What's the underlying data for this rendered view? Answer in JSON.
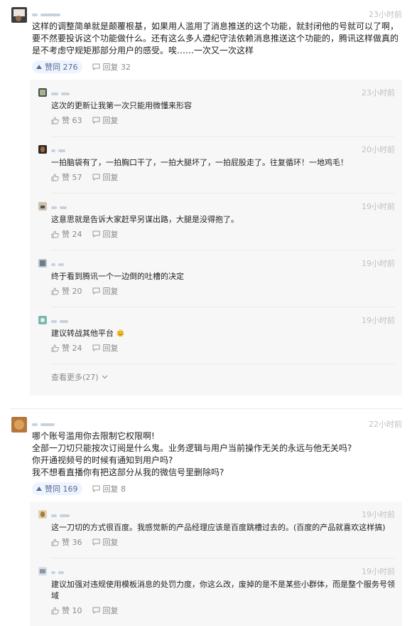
{
  "comments": [
    {
      "time": "23小时前",
      "text": "这样的调整简单就是颠覆根基，如果用人滥用了消息推送的这个功能，就封闭他的号就可以了啊，要不然要投诉这个功能做什么。还有这么多人遵纪守法依赖消息推送这个功能的，腾讯这样做真的是不考虑守规矩那部分用户的感受。唉……一次又一次这样",
      "likes": "赞同 276",
      "reply_count": "回复 32",
      "replies": [
        {
          "time": "23小时前",
          "text": "这次的更新让我第一次只能用微懂来形容",
          "likes": "赞 63",
          "reply_label": "回复"
        },
        {
          "time": "20小时前",
          "text": "一拍脑袋有了，一拍胸口干了，一拍大腿坏了，一拍屁股走了。往复循环！一地鸡毛！",
          "likes": "赞 57",
          "reply_label": "回复"
        },
        {
          "time": "19小时前",
          "text": "这意思就是告诉大家赶早另谋出路，大腿是没得抱了。",
          "likes": "赞 24",
          "reply_label": "回复"
        },
        {
          "time": "19小时前",
          "text": "终于看到腾讯一个一边倒的吐槽的决定",
          "likes": "赞 20",
          "reply_label": "回复"
        },
        {
          "time": "19小时前",
          "text": "建议转战其他平台",
          "likes": "赞 24",
          "reply_label": "回复"
        }
      ],
      "more_label": "查看更多(27)"
    },
    {
      "time": "22小时前",
      "text_lines": [
        "哪个账号滥用你去限制它权限啊!",
        "全部一刀切只能按次订阅是什么鬼。业务逻辑与用户当前操作无关的永远与他无关吗?",
        "你开通视频号的时候有通知到用户吗?",
        "我不想看直播你有把这部分从我的微信号里删除吗?"
      ],
      "likes": "赞同 169",
      "reply_count": "回复 8",
      "replies": [
        {
          "time": "19小时前",
          "text": "这一刀切的方式很百度。我感觉新的产品经理应该是百度跳槽过去的。(百度的产品就喜欢这样搞)",
          "likes": "赞 36",
          "reply_label": "回复"
        },
        {
          "time": "19小时前",
          "text": "建议加强对违规使用模板消息的处罚力度，你这么改，废掉的是不是某些小群体，而是整个服务号领域",
          "likes": "赞 10",
          "reply_label": "回复"
        }
      ]
    }
  ],
  "colors": {
    "accent": "#576b95",
    "like_bg": "#eef4ff",
    "reply_bg": "#f7f7f7",
    "emoji": "#f5c542"
  },
  "icons": {
    "like": "thumb-up-icon",
    "reply": "speech-bubble-icon",
    "more": "chevron-down-icon",
    "upvote": "triangle-up-icon"
  }
}
